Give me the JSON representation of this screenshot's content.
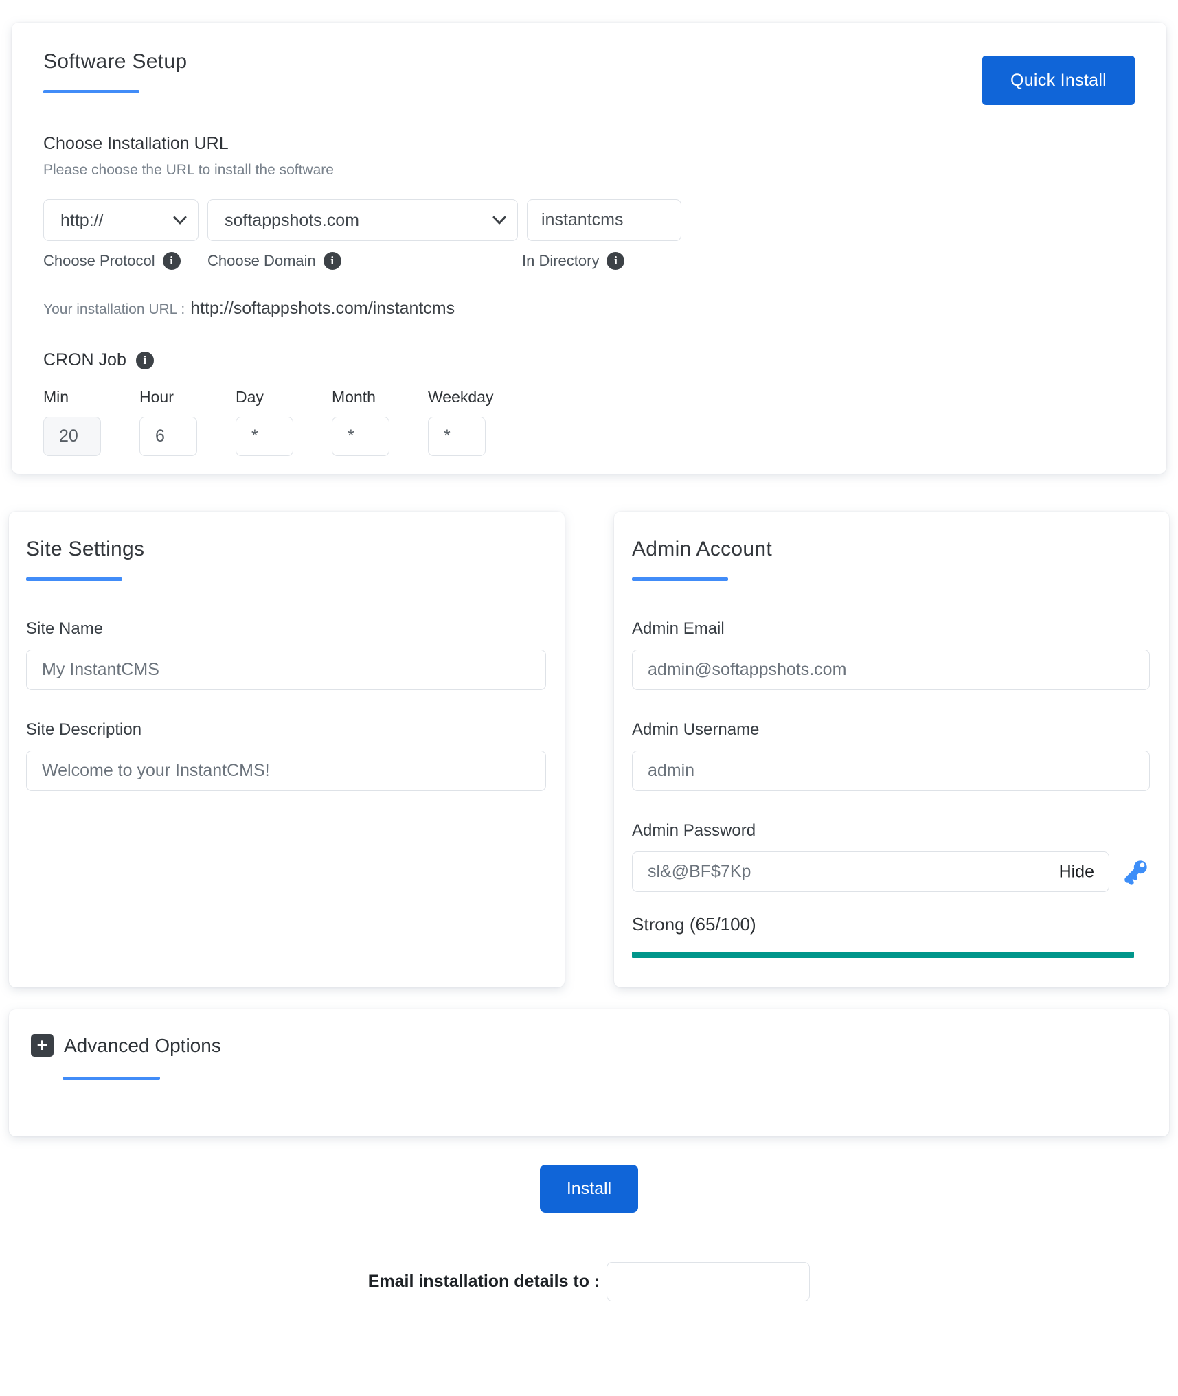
{
  "colors": {
    "accent_blue": "#1065d8",
    "underline_blue": "#418cf8",
    "strength_teal": "#00968b",
    "key_blue": "#3d8ef8"
  },
  "icons": {
    "info_glyph": "i",
    "plus_glyph": "+"
  },
  "software_setup": {
    "title": "Software Setup",
    "quick_install_label": "Quick Install",
    "installation_url": {
      "heading": "Choose Installation URL",
      "subheading": "Please choose the URL to install the software",
      "protocol": {
        "label": "Choose Protocol",
        "value": "http://"
      },
      "domain": {
        "label": "Choose Domain",
        "value": "softappshots.com"
      },
      "directory": {
        "label": "In Directory",
        "value": "instantcms"
      },
      "result_label": "Your installation URL :",
      "result_value": "http://softappshots.com/instantcms"
    },
    "cron": {
      "heading": "CRON Job",
      "fields": [
        {
          "label": "Min",
          "value": "20"
        },
        {
          "label": "Hour",
          "value": "6"
        },
        {
          "label": "Day",
          "value": "*"
        },
        {
          "label": "Month",
          "value": "*"
        },
        {
          "label": "Weekday",
          "value": "*"
        }
      ]
    }
  },
  "site_settings": {
    "title": "Site Settings",
    "site_name": {
      "label": "Site Name",
      "value": "My InstantCMS"
    },
    "site_description": {
      "label": "Site Description",
      "value": "Welcome to your InstantCMS!"
    }
  },
  "admin_account": {
    "title": "Admin Account",
    "email": {
      "label": "Admin Email",
      "value": "admin@softappshots.com"
    },
    "username": {
      "label": "Admin Username",
      "value": "admin"
    },
    "password": {
      "label": "Admin Password",
      "value": "sl&@BF$7Kp",
      "toggle_label": "Hide",
      "strength_text": "Strong (65/100)"
    }
  },
  "advanced_options": {
    "title": "Advanced Options"
  },
  "footer": {
    "install_label": "Install",
    "email_details_label": "Email installation details to :"
  }
}
